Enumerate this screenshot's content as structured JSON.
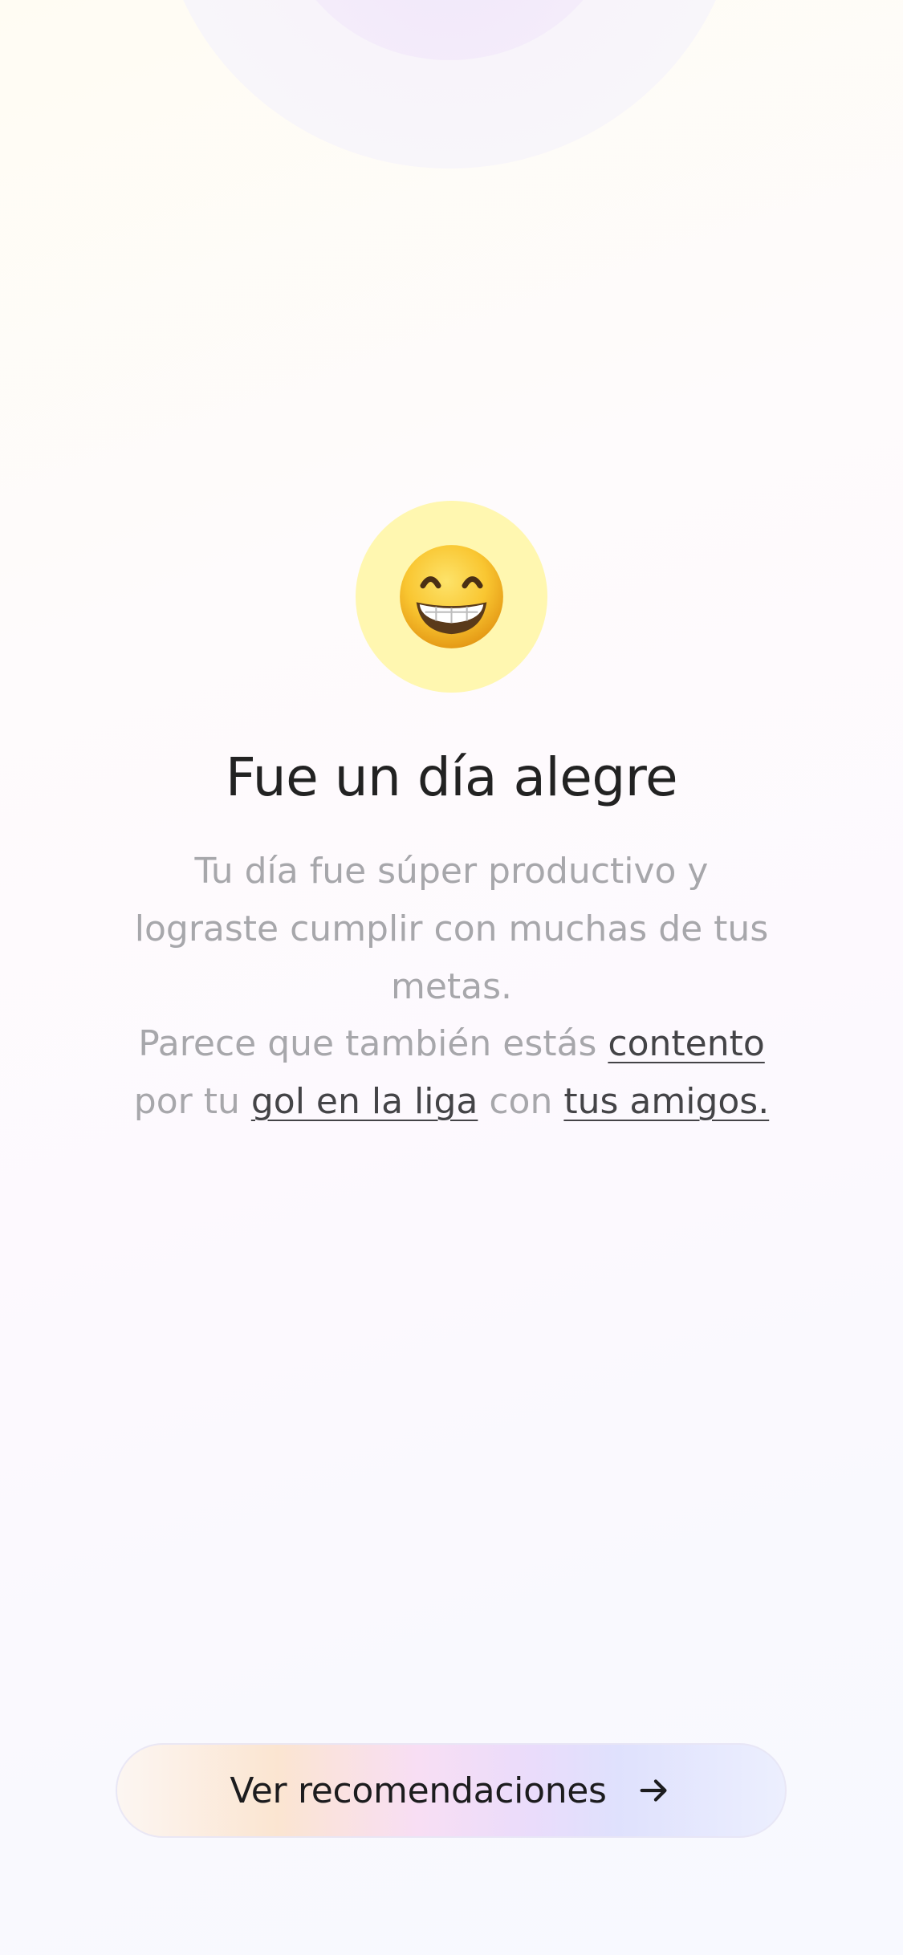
{
  "mood": {
    "emoji_icon": "grinning-face-with-smiling-eyes-icon",
    "emoji_bg": "#fff7b0",
    "title": "Fue un día alegre",
    "description": "Tu día fue súper productivo y lograste cumplir con muchas de tus metas."
  },
  "insight": {
    "text_1": "Parece que también estás ",
    "link_emotion": "contento",
    "text_2": " por tu ",
    "link_activity": "gol en la liga",
    "text_3": " con ",
    "link_people": "tus amigos."
  },
  "cta": {
    "label": "Ver recomendaciones",
    "icon": "arrow-right-icon"
  }
}
